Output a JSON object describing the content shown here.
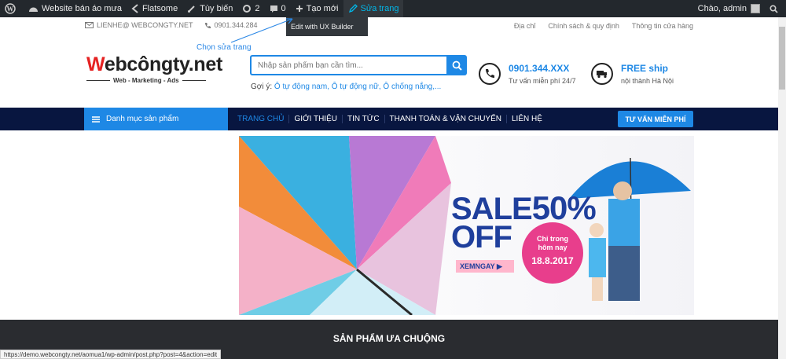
{
  "adminbar": {
    "site_name": "Website bán áo mưa",
    "theme": "Flatsome",
    "customize": "Tùy biến",
    "updates_count": "2",
    "comments_count": "0",
    "new_label": "Tạo mới",
    "edit_label": "Sửa trang",
    "greeting": "Chào, admin",
    "dropdown_item": "Edit with UX Builder"
  },
  "annotation": "Chọn sửa trang",
  "topbar": {
    "email": "LIENHE@ WEBCONGTY.NET",
    "phone": "0901.344.284",
    "links": [
      "Địa chỉ",
      "Chính sách & quy định",
      "Thông tin cửa hàng"
    ]
  },
  "logo": {
    "text": "ebcôngty.net",
    "w": "W",
    "tagline": "Web - Marketing - Ads"
  },
  "search": {
    "placeholder": "Nhập sản phẩm bạn cần tìm...",
    "suggest_prefix": "Gợi ý:",
    "suggest_links": "Ô tự động nam, Ô tự động nữ, Ô chống nắng,..."
  },
  "contacts": [
    {
      "title": "0901.344.XXX",
      "sub": "Tư vấn miễn phí 24/7"
    },
    {
      "title": "FREE ship",
      "sub": "nội thành Hà Nội"
    }
  ],
  "nav": {
    "category": "Danh mục sản phẩm",
    "links": [
      "TRANG CHỦ",
      "GIỚI THIỆU",
      "TIN TỨC",
      "THANH TOÁN & VẬN CHUYỂN",
      "LIÊN HỆ"
    ],
    "cta": "TƯ VẤN MIỄN PHÍ"
  },
  "banner": {
    "sale": "SALE",
    "percent": "50%",
    "off": "OFF",
    "xem": "XEMNGAY ▶",
    "promo_line1": "Chỉ trong",
    "promo_line2": "hôm nay",
    "promo_date": "18.8.2017"
  },
  "section_title": "SẢN PHẨM ƯA CHUỘNG",
  "status_url": "https://demo.webcongty.net/aomua1/wp-admin/post.php?post=4&action=edit",
  "colors": {
    "accent": "#1e88e5",
    "nav": "#081640",
    "adminbar": "#23282d"
  }
}
